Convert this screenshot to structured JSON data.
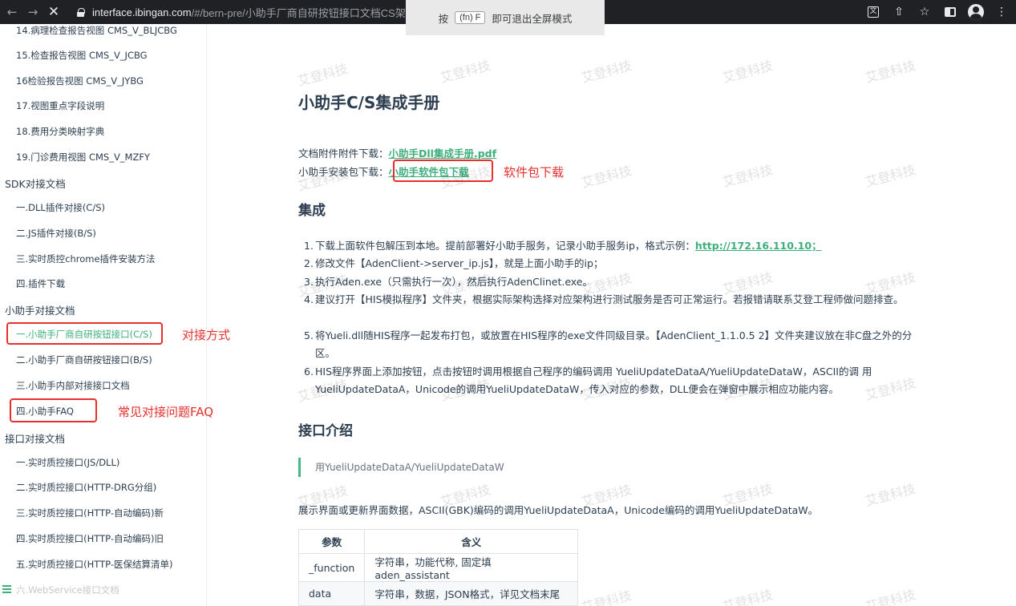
{
  "browser": {
    "url_host": "interface.ibingan.com",
    "url_path": "/#/bern-pre/小助手厂商自研按钮接口文档CS架构",
    "fullscreen_hint": {
      "before": "按",
      "key": "(fn) F",
      "after": "即可退出全屏模式"
    }
  },
  "sidebar": {
    "items": [
      {
        "label": "14.病理检查报告视图 CMS_V_BLJCBG"
      },
      {
        "label": "15.检查报告视图 CMS_V_JCBG"
      },
      {
        "label": "16检验报告视图 CMS_V_JYBG"
      },
      {
        "label": "17.视图重点字段说明"
      },
      {
        "label": "18.费用分类映射字典"
      },
      {
        "label": "19.门诊费用视图 CMS_V_MZFY"
      },
      {
        "group": "SDK对接文档"
      },
      {
        "label": "一.DLL插件对接(C/S)"
      },
      {
        "label": "二.JS插件对接(B/S)"
      },
      {
        "label": "三.实时质控chrome插件安装方法"
      },
      {
        "label": "四.插件下载"
      },
      {
        "group": "小助手对接文档"
      },
      {
        "label": "一.小助手厂商自研按钮接口(C/S)",
        "active": true
      },
      {
        "label": "二.小助手厂商自研按钮接口(B/S)"
      },
      {
        "label": "三.小助手内部对接接口文档"
      },
      {
        "label": "四.小助手FAQ"
      },
      {
        "group": "接口对接文档"
      },
      {
        "label": "一.实时质控接口(JS/DLL)"
      },
      {
        "label": "二.实时质控接口(HTTP-DRG分组)"
      },
      {
        "label": "三.实时质控接口(HTTP-自动编码)新"
      },
      {
        "label": "四.实时质控接口(HTTP-自动编码)旧"
      },
      {
        "label": "五.实时质控接口(HTTP-医保结算清单)"
      },
      {
        "label": "六.WebService接口文档",
        "faded": true
      }
    ]
  },
  "annotations": {
    "method": "对接方式",
    "faq": "常见对接问题FAQ",
    "download": "软件包下载"
  },
  "content": {
    "title": "小助手C/S集成手册",
    "attach_label": "文档附件附件下载：",
    "attach_link": "小助手Dll集成手册.pdf",
    "install_label": "小助手安装包下载：",
    "install_link": "小助手软件包下载",
    "section_integration": "集成",
    "steps": [
      {
        "num": "1.",
        "text": "下载上面软件包解压到本地。提前部署好小助手服务，记录小助手服务ip，格式示例：",
        "link": "http://172.16.110.10；"
      },
      {
        "num": "2.",
        "text": "修改文件【AdenClient->server_ip.js】，就是上面小助手的ip；"
      },
      {
        "num": "3.",
        "text": "执行Aden.exe（只需执行一次），然后执行AdenClinet.exe。"
      },
      {
        "num": "4.",
        "text": "建议打开【HIS模拟程序】文件夹，根据实际架构选择对应架构进行测试服务是否可正常运行。若报错请联系艾登工程师做问题排查。"
      },
      {
        "num": "5.",
        "text": "将Yueli.dll随HIS程序一起发布打包，或放置在HIS程序的exe文件同级目录。【AdenClient_1.1.0.5 2】文件夹建议放在非C盘之外的分区。"
      },
      {
        "num": "6.",
        "text": "HIS程序界面上添加按钮，点击按钮时调用根据自己程序的编码调用 YueliUpdateDataA/YueliUpdateDataW，ASCII的调 用YueliUpdateDataA，Unicode的调用YueliUpdateDataW，传入对应的参数，DLL便会在弹窗中展示相应功能内容。"
      }
    ],
    "section_api": "接口介绍",
    "tip": "用YueliUpdateDataA/YueliUpdateDataW",
    "api_desc": "展示界面或更新界面数据，ASCII(GBK)编码的调用YueliUpdateDataA，Unicode编码的调用YueliUpdateDataW。",
    "table": {
      "headers": [
        "参数",
        "含义"
      ],
      "rows": [
        [
          "_function",
          "字符串，功能代称, 固定填 aden_assistant"
        ],
        [
          "data",
          "字符串，数据，JSON格式，详见文档末尾"
        ]
      ]
    }
  },
  "watermark": "艾登科技",
  "colors": {
    "accent": "#3eaf7c",
    "annotation_red": "#e5302b",
    "browser_bar": "#202124"
  }
}
